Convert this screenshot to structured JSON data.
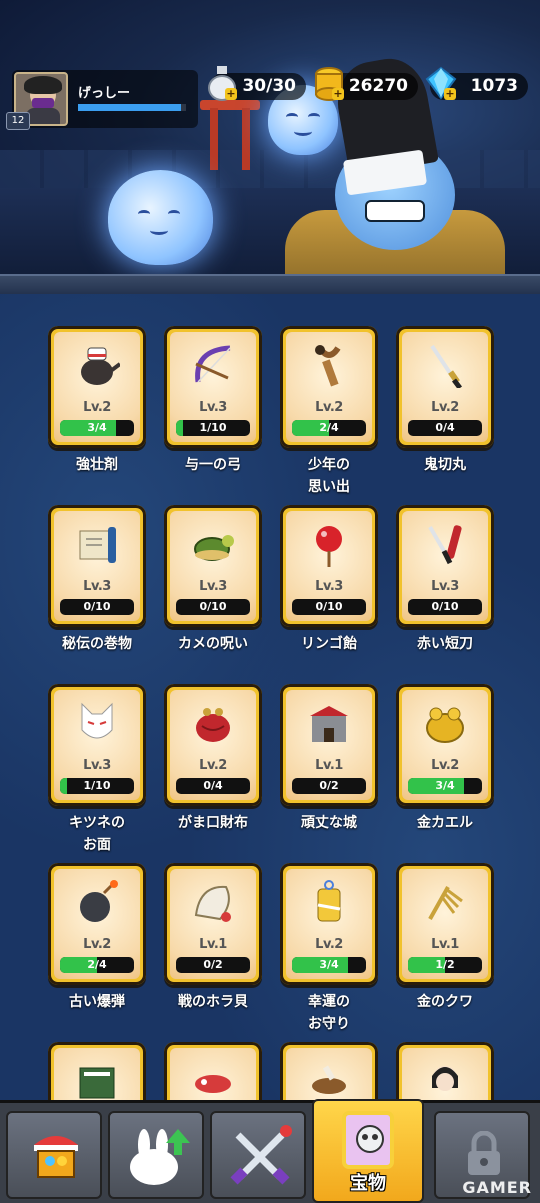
{
  "player": {
    "name": "げっしー",
    "level": "12",
    "xp_fraction": 0.95
  },
  "resources": {
    "stamina": {
      "value": "30/30",
      "icon": "sake-bottle-icon"
    },
    "gold": {
      "value": "26270",
      "icon": "gold-coin-stack-icon"
    },
    "gems": {
      "value": "1073",
      "icon": "blue-gem-icon"
    }
  },
  "treasures": [
    {
      "name": "強壮剤",
      "level": "Lv.2",
      "progress": "3/4",
      "fraction": 0.75,
      "icon": "teapot-icon"
    },
    {
      "name": "与一の弓",
      "level": "Lv.3",
      "progress": "1/10",
      "fraction": 0.1,
      "icon": "bow-icon"
    },
    {
      "name": "少年の\n思い出",
      "level": "Lv.2",
      "progress": "2/4",
      "fraction": 0.5,
      "icon": "slingshot-icon"
    },
    {
      "name": "鬼切丸",
      "level": "Lv.2",
      "progress": "0/4",
      "fraction": 0,
      "icon": "katana-icon"
    },
    {
      "name": "秘伝の巻物",
      "level": "Lv.3",
      "progress": "0/10",
      "fraction": 0,
      "icon": "scroll-icon"
    },
    {
      "name": "カメの呪い",
      "level": "Lv.3",
      "progress": "0/10",
      "fraction": 0,
      "icon": "turtle-icon"
    },
    {
      "name": "リンゴ飴",
      "level": "Lv.3",
      "progress": "0/10",
      "fraction": 0,
      "icon": "candy-apple-icon"
    },
    {
      "name": "赤い短刀",
      "level": "Lv.3",
      "progress": "0/10",
      "fraction": 0,
      "icon": "dagger-icon"
    },
    {
      "name": "キツネの\nお面",
      "level": "Lv.3",
      "progress": "1/10",
      "fraction": 0.1,
      "icon": "fox-mask-icon"
    },
    {
      "name": "がま口財布",
      "level": "Lv.2",
      "progress": "0/4",
      "fraction": 0,
      "icon": "coin-purse-icon"
    },
    {
      "name": "頑丈な城",
      "level": "Lv.1",
      "progress": "0/2",
      "fraction": 0,
      "icon": "castle-icon"
    },
    {
      "name": "金カエル",
      "level": "Lv.2",
      "progress": "3/4",
      "fraction": 0.75,
      "icon": "gold-frog-icon"
    },
    {
      "name": "古い爆弾",
      "level": "Lv.2",
      "progress": "2/4",
      "fraction": 0.5,
      "icon": "bomb-icon"
    },
    {
      "name": "戦のホラ貝",
      "level": "Lv.1",
      "progress": "0/2",
      "fraction": 0,
      "icon": "conch-shell-icon"
    },
    {
      "name": "幸運の\nお守り",
      "level": "Lv.2",
      "progress": "3/4",
      "fraction": 0.75,
      "icon": "omamori-charm-icon"
    },
    {
      "name": "金のクワ",
      "level": "Lv.1",
      "progress": "1/2",
      "fraction": 0.5,
      "icon": "gold-rake-icon"
    }
  ],
  "partial_row_icons": [
    "green-book-icon",
    "koinobori-icon",
    "sake-cup-icon",
    "doll-icon"
  ],
  "tabs": [
    {
      "id": "shop",
      "label": "",
      "icon": "shop-stall-icon"
    },
    {
      "id": "upgrade",
      "label": "",
      "icon": "rabbit-upgrade-icon"
    },
    {
      "id": "battle",
      "label": "",
      "icon": "crossed-swords-icon"
    },
    {
      "id": "treasure",
      "label": "宝物",
      "icon": "treasure-card-icon",
      "active": true
    },
    {
      "id": "locked",
      "label": "",
      "icon": "lock-icon"
    }
  ],
  "watermark": "GAMER",
  "colors": {
    "card_gold": "#f1c22c",
    "progress_green": "#32c24a",
    "xp_blue": "#3b9ef0"
  }
}
